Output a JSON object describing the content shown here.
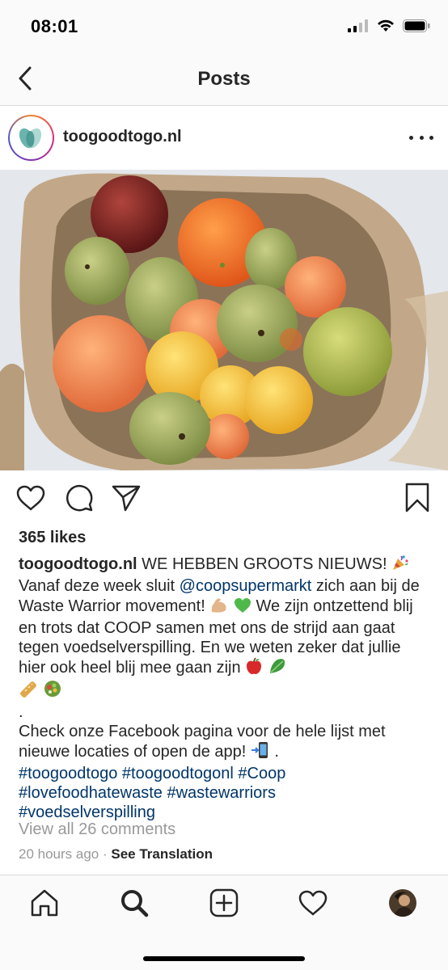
{
  "status_bar": {
    "time": "08:01"
  },
  "nav": {
    "title": "Posts"
  },
  "post": {
    "username": "toogoodtogo.nl",
    "likes": "365 likes",
    "caption": {
      "username": "toogoodtogo.nl",
      "line1": " WE HEBBEN GROOTS NIEUWS! ",
      "line2a": "Vanaf deze week sluit ",
      "mention": "@coopsupermarkt",
      "line2b": " zich aan bij de Waste Warrior movement! ",
      "line2c": " We zijn ontzettend blij en trots dat COOP samen met ons de strijd aan gaat tegen voedselverspilling. En we weten zeker dat jullie hier ook heel blij mee gaan zijn ",
      "dot": ".",
      "line3": "Check onze Facebook pagina voor de hele lijst met nieuwe locaties of open de app! ",
      "line3end": " .",
      "hashtags": [
        "#toogoodtogo",
        "#toogoodtogonl",
        "#Coop",
        "#lovefoodhatewaste",
        "#wastewarriors",
        "#voedselverspilling"
      ]
    },
    "view_comments": "View all 26 comments",
    "time_ago": "20 hours ago",
    "separator": " · ",
    "see_translation": "See Translation"
  },
  "icons": {
    "back": "chevron-left-icon",
    "more": "more-horizontal-icon",
    "like": "heart-icon",
    "comment": "comment-icon",
    "share": "direct-send-icon",
    "save": "bookmark-icon",
    "tabs": [
      "home-icon",
      "search-icon",
      "new-post-icon",
      "activity-heart-icon",
      "profile-avatar"
    ]
  },
  "colors": {
    "link": "#003569",
    "muted": "#999999",
    "text": "#262626",
    "border": "#dbdbdb"
  }
}
